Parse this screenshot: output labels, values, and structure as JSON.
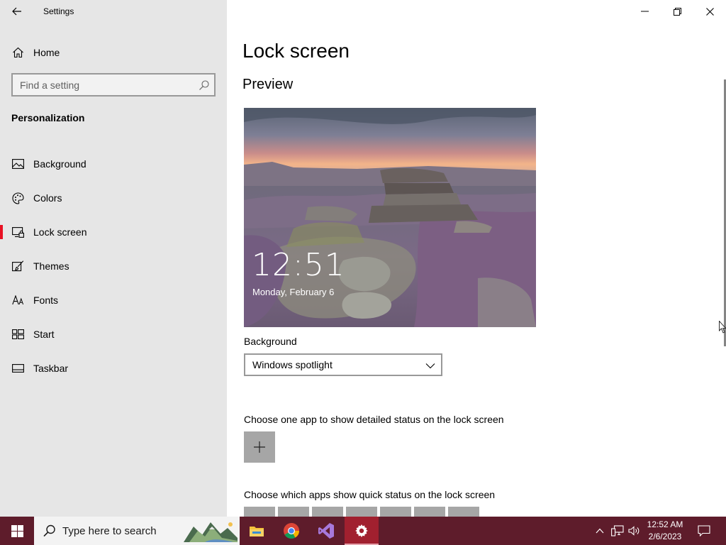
{
  "window": {
    "title": "Settings"
  },
  "sidebar": {
    "home_label": "Home",
    "search_placeholder": "Find a setting",
    "section_title": "Personalization",
    "items": [
      {
        "label": "Background",
        "icon": "picture-icon",
        "active": false
      },
      {
        "label": "Colors",
        "icon": "palette-icon",
        "active": false
      },
      {
        "label": "Lock screen",
        "icon": "lock-screen-icon",
        "active": true
      },
      {
        "label": "Themes",
        "icon": "brush-icon",
        "active": false
      },
      {
        "label": "Fonts",
        "icon": "font-icon",
        "active": false
      },
      {
        "label": "Start",
        "icon": "start-icon",
        "active": false
      },
      {
        "label": "Taskbar",
        "icon": "taskbar-icon",
        "active": false
      }
    ],
    "accent_color": "#e81123"
  },
  "main": {
    "page_title": "Lock screen",
    "preview_heading": "Preview",
    "preview": {
      "time": "12:51",
      "date": "Monday, February 6"
    },
    "background_label": "Background",
    "background_value": "Windows spotlight",
    "detailed_status_label": "Choose one app to show detailed status on the lock screen",
    "quick_status_label": "Choose which apps show quick status on the lock screen"
  },
  "taskbar": {
    "search_placeholder": "Type here to search",
    "apps": [
      "file-explorer-icon",
      "chrome-icon",
      "visual-studio-icon",
      "settings-gear-icon"
    ],
    "clock_time": "12:52 AM",
    "clock_date": "2/6/2023",
    "color": "#5e1c2b"
  }
}
